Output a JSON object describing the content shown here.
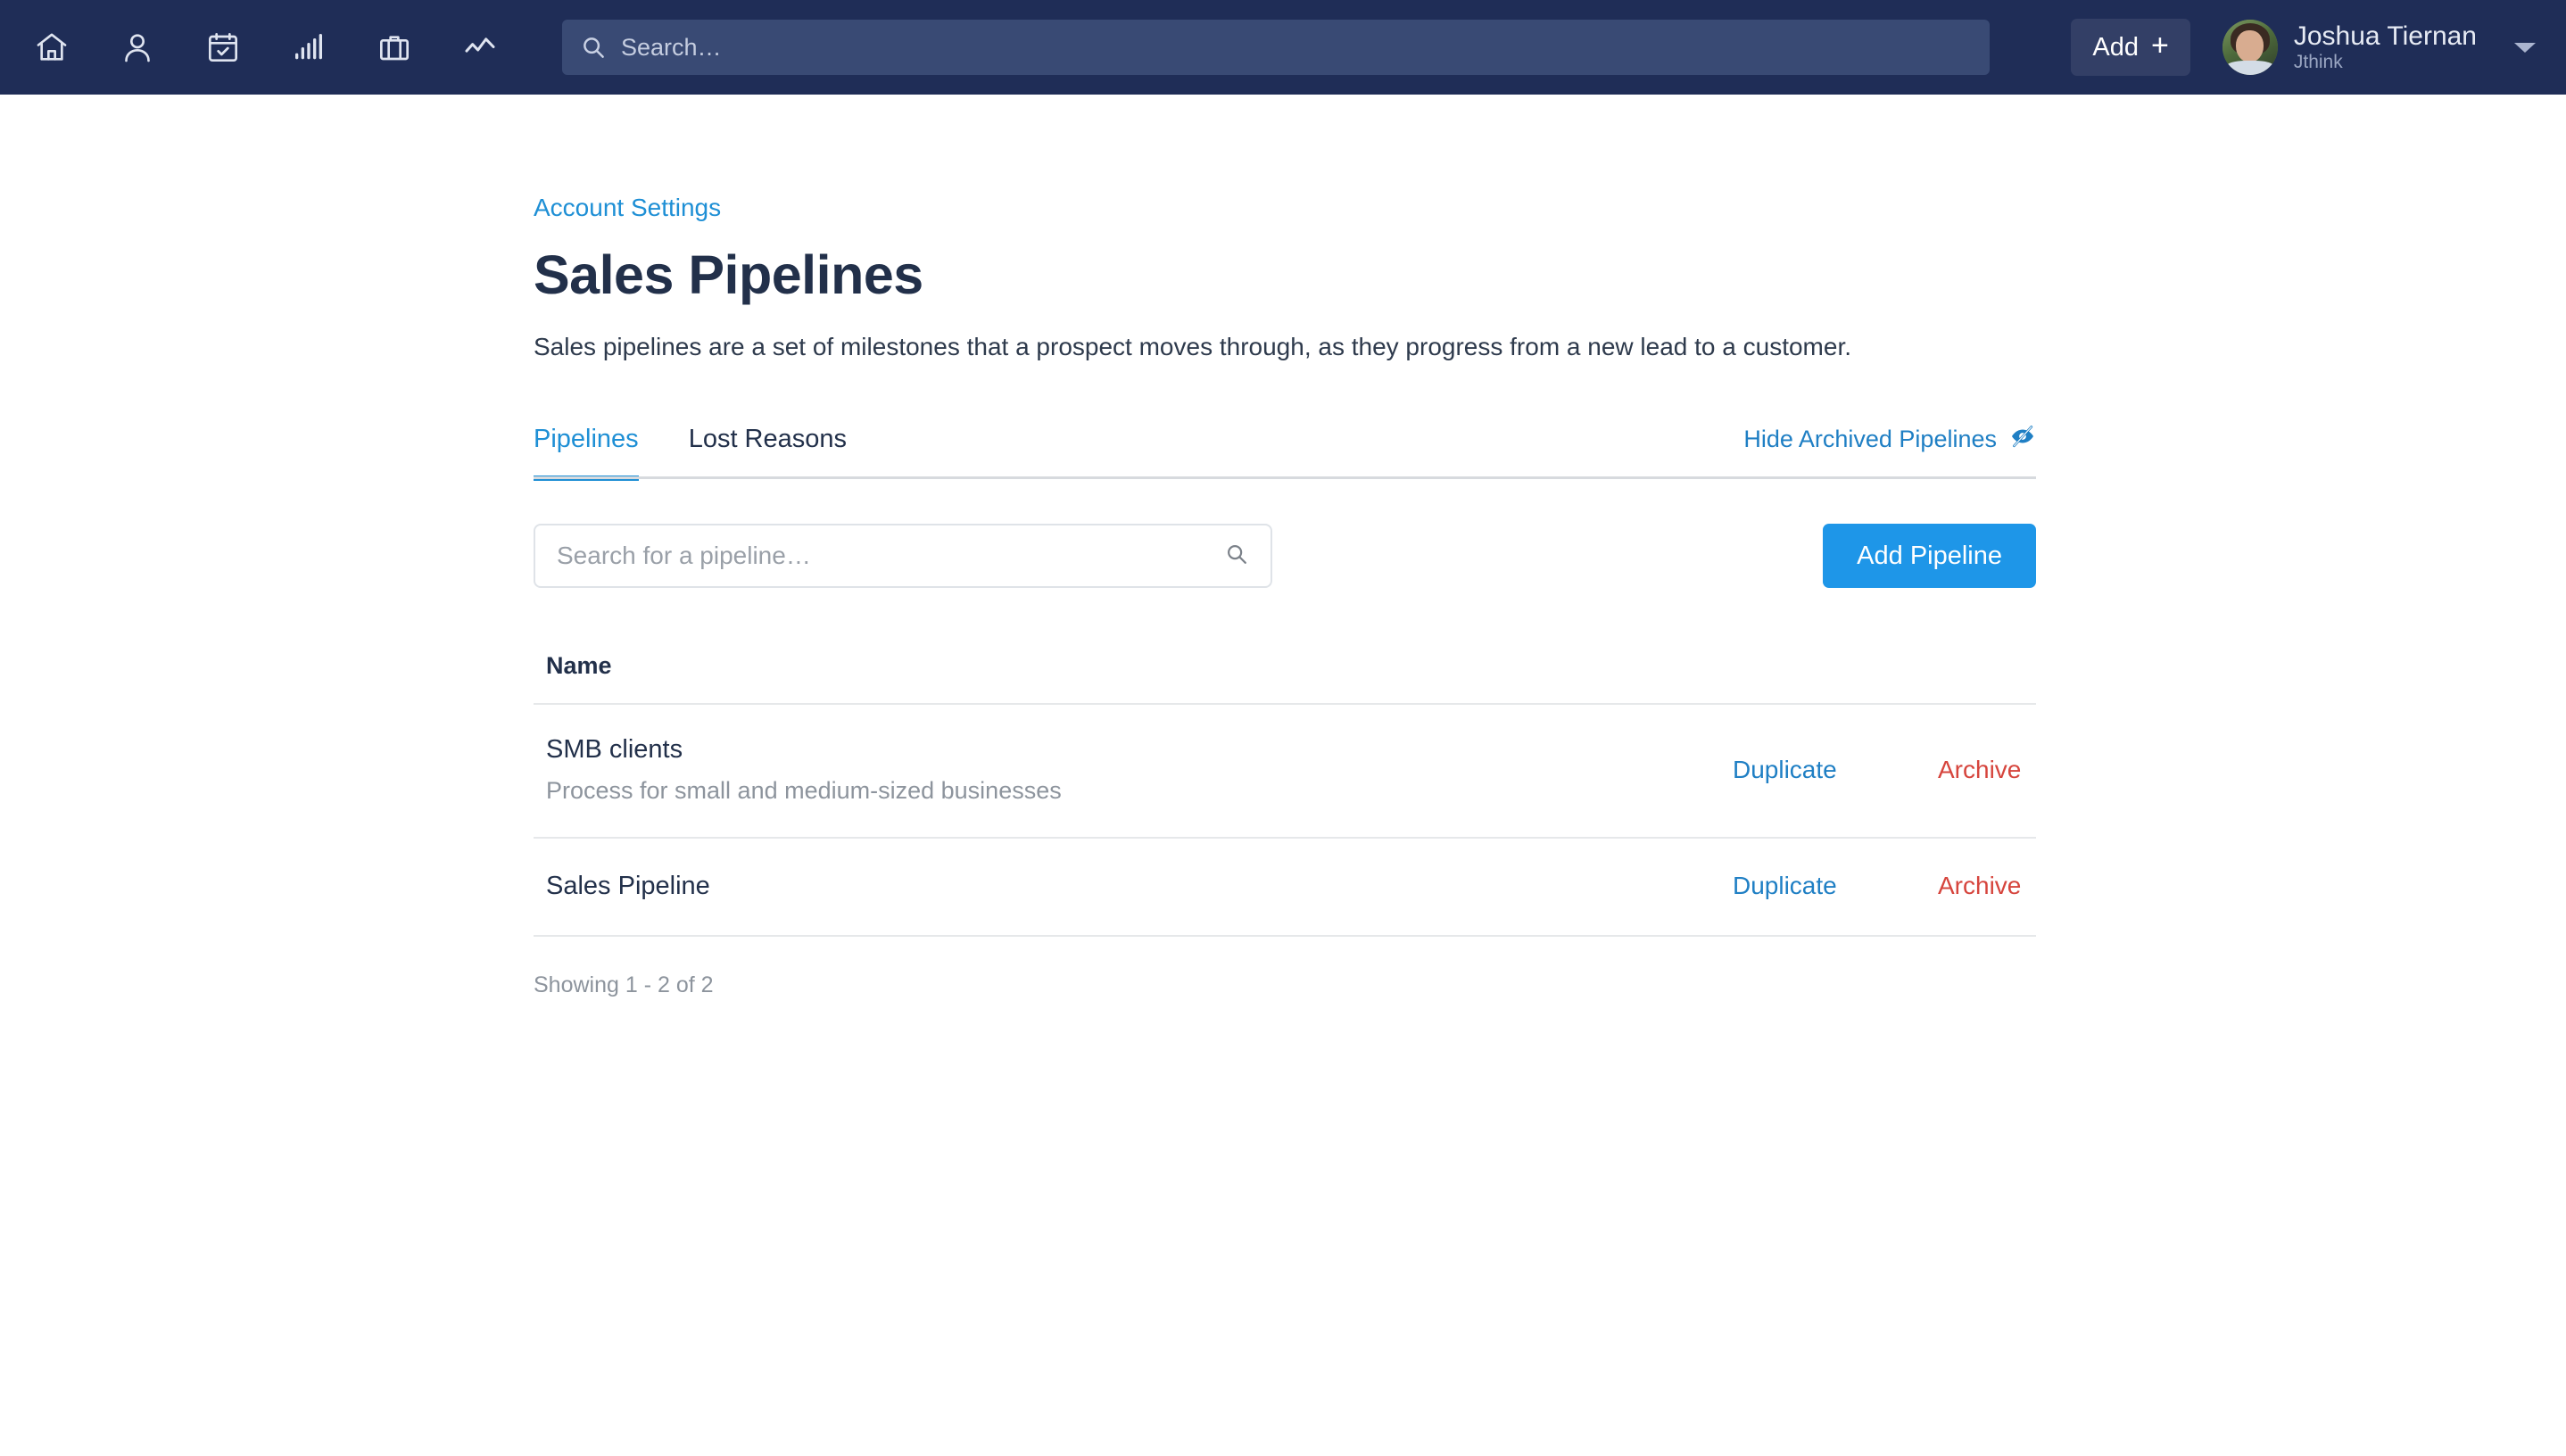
{
  "topbar": {
    "nav_icons": [
      {
        "name": "home-icon",
        "label": "Home"
      },
      {
        "name": "contacts-icon",
        "label": "Contacts"
      },
      {
        "name": "calendar-check-icon",
        "label": "Calendar"
      },
      {
        "name": "bar-chart-icon",
        "label": "Reports"
      },
      {
        "name": "briefcase-icon",
        "label": "Deals"
      },
      {
        "name": "trend-line-icon",
        "label": "Activity"
      }
    ],
    "search": {
      "placeholder": "Search…",
      "value": "",
      "icon": "search-icon"
    },
    "add_button": {
      "label": "Add",
      "plus": "+"
    },
    "user": {
      "name": "Joshua Tiernan",
      "org": "Jthink",
      "avatar": "user-avatar",
      "caret": "chevron-down-icon"
    },
    "colors": {
      "bar_background": "#1f2d57",
      "search_background": "#394a74",
      "add_button_background": "#333f66"
    }
  },
  "main": {
    "breadcrumb": "Account Settings",
    "title": "Sales Pipelines",
    "description": "Sales pipelines are a set of milestones that a prospect moves through, as they progress from a new lead to a customer.",
    "tabs": [
      {
        "label": "Pipelines",
        "active": true
      },
      {
        "label": "Lost Reasons",
        "active": false
      }
    ],
    "hide_archived": {
      "label": "Hide Archived Pipelines",
      "icon": "eye-slash-icon"
    },
    "toolbar": {
      "search_placeholder": "Search for a pipeline…",
      "search_value": "",
      "search_icon": "search-icon",
      "add_pipeline_label": "Add Pipeline"
    },
    "table": {
      "columns": [
        "Name"
      ],
      "rows": [
        {
          "name": "SMB clients",
          "description": "Process for small and medium-sized businesses",
          "duplicate_label": "Duplicate",
          "archive_label": "Archive"
        },
        {
          "name": "Sales Pipeline",
          "description": "",
          "duplicate_label": "Duplicate",
          "archive_label": "Archive"
        }
      ],
      "footer": "Showing 1 - 2 of 2"
    },
    "colors": {
      "link_blue": "#1e8fd5",
      "primary_button": "#1e96e8",
      "danger_red": "#d6453d",
      "heading": "#22304a",
      "muted": "#8d949d"
    }
  }
}
